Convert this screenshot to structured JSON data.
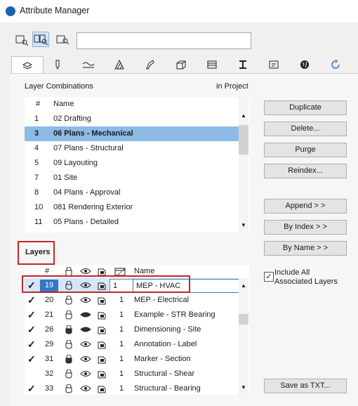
{
  "window": {
    "title": "Attribute Manager"
  },
  "search": {
    "placeholder": "",
    "value": ""
  },
  "view_buttons": [
    "list-view",
    "split-view",
    "detail-view"
  ],
  "tabs": [
    {
      "icon": "layers-icon",
      "active": true
    },
    {
      "icon": "pen-icon"
    },
    {
      "icon": "line-type-icon"
    },
    {
      "icon": "fill-icon"
    },
    {
      "icon": "surface-icon"
    },
    {
      "icon": "composite-icon"
    },
    {
      "icon": "zone-icon"
    },
    {
      "icon": "profile-icon"
    },
    {
      "icon": "markup-icon"
    },
    {
      "icon": "globe-icon"
    },
    {
      "icon": "refresh-icon"
    }
  ],
  "combinations": {
    "title": "Layer Combinations",
    "location": "in Project",
    "columns": {
      "num": "#",
      "name": "Name"
    },
    "rows": [
      {
        "num": "1",
        "name": "02 Drafting"
      },
      {
        "num": "3",
        "name": "06 Plans - Mechanical",
        "selected": true
      },
      {
        "num": "4",
        "name": "07 Plans - Structural"
      },
      {
        "num": "5",
        "name": "09 Layouting"
      },
      {
        "num": "7",
        "name": "01 Site"
      },
      {
        "num": "8",
        "name": "04 Plans - Approval"
      },
      {
        "num": "10",
        "name": "081 Rendering Exterior"
      },
      {
        "num": "11",
        "name": "05 Plans - Detailed"
      }
    ]
  },
  "buttons": {
    "duplicate": "Duplicate",
    "delete": "Delete...",
    "purge": "Purge",
    "reindex": "Reindex...",
    "append": "Append > >",
    "by_index": "By Index > >",
    "by_name": "By Name > >",
    "save_txt": "Save as TXT..."
  },
  "layers": {
    "title": "Layers",
    "columns": {
      "num": "#",
      "name": "Name"
    },
    "rows": [
      {
        "check": "✓",
        "num": "19",
        "pen": "1",
        "name": "MEP - HVAC",
        "editing": true
      },
      {
        "check": "✓",
        "num": "20",
        "pen": "1",
        "name": "MEP - Electrical"
      },
      {
        "check": "✓",
        "num": "21",
        "pen": "1",
        "name": "Example - STR Bearing"
      },
      {
        "check": "✓",
        "num": "26",
        "pen": "1",
        "name": "Dimensioning - Site"
      },
      {
        "check": "✓",
        "num": "29",
        "pen": "1",
        "name": "Annotation - Label"
      },
      {
        "check": "✓",
        "num": "31",
        "pen": "1",
        "name": "Marker - Section"
      },
      {
        "check": "",
        "num": "32",
        "pen": "1",
        "name": "Structural - Shear"
      },
      {
        "check": "✓",
        "num": "33",
        "pen": "1",
        "name": "Structural - Bearing"
      }
    ]
  },
  "include_all": {
    "label": "Include All Associated Layers",
    "checked": true
  }
}
